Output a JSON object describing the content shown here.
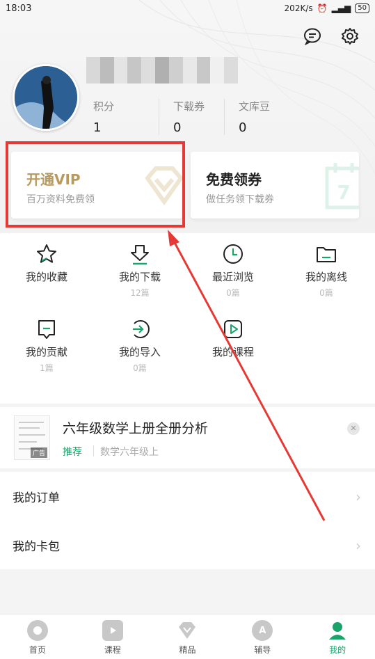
{
  "status": {
    "time": "18:03",
    "network": "202K/s",
    "battery": "50"
  },
  "profile": {
    "stats": [
      {
        "label": "积分",
        "value": "1"
      },
      {
        "label": "下载券",
        "value": "0"
      },
      {
        "label": "文库豆",
        "value": "0"
      }
    ]
  },
  "cards": {
    "vip": {
      "title": "开通VIP",
      "subtitle": "百万资料免费领"
    },
    "coupon": {
      "title": "免费领券",
      "subtitle": "做任务领下载券"
    }
  },
  "features": [
    {
      "label": "我的收藏",
      "count": "",
      "icon": "star-icon"
    },
    {
      "label": "我的下载",
      "count": "12篇",
      "icon": "download-icon"
    },
    {
      "label": "最近浏览",
      "count": "0篇",
      "icon": "clock-icon"
    },
    {
      "label": "我的离线",
      "count": "0篇",
      "icon": "folder-icon"
    },
    {
      "label": "我的贡献",
      "count": "1篇",
      "icon": "contribution-icon"
    },
    {
      "label": "我的导入",
      "count": "0篇",
      "icon": "import-icon"
    },
    {
      "label": "我的课程",
      "count": "",
      "icon": "play-icon"
    }
  ],
  "ad": {
    "title": "六年级数学上册全册分析",
    "tag": "推荐",
    "category": "数学六年级上",
    "badge": "广告"
  },
  "menu": [
    {
      "label": "我的订单"
    },
    {
      "label": "我的卡包"
    }
  ],
  "tabs": [
    {
      "label": "首页",
      "icon": "home-icon"
    },
    {
      "label": "课程",
      "icon": "course-icon"
    },
    {
      "label": "精品",
      "icon": "diamond-icon"
    },
    {
      "label": "辅导",
      "icon": "tutor-icon"
    },
    {
      "label": "我的",
      "icon": "profile-icon"
    }
  ],
  "colors": {
    "accent": "#1aa36b",
    "vip": "#b99a5e",
    "highlight": "#e53935"
  }
}
